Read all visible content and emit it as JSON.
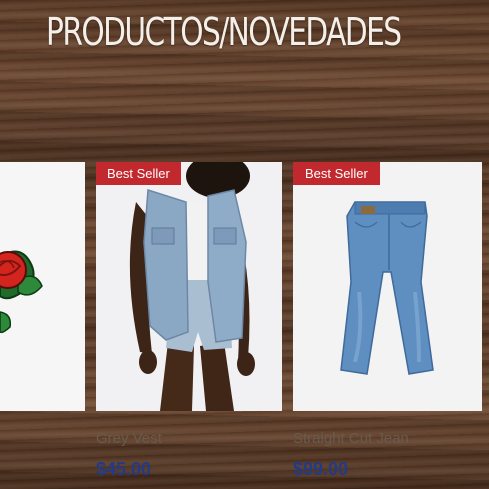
{
  "header": {
    "title": "PRODUCTOS/NOVEDADES"
  },
  "products": [
    {
      "badge": "",
      "name": "",
      "price": "",
      "image": "rose-patch-image"
    },
    {
      "badge": "Best Seller",
      "name": "Grey Vest",
      "price": "$45.00",
      "image": "denim-vest-image"
    },
    {
      "badge": "Best Seller",
      "name": "Straight Cut Jean",
      "price": "$99.00",
      "image": "jeans-image"
    }
  ],
  "colors": {
    "badge": "#c1292f",
    "price": "#233a86",
    "title": "#f4efe9"
  }
}
